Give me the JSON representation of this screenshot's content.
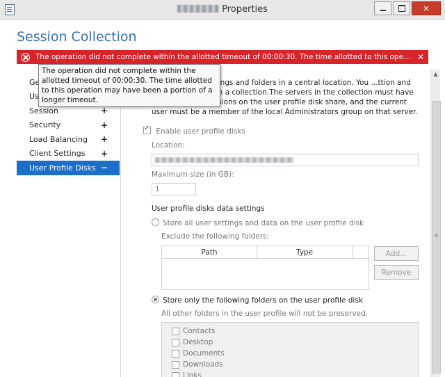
{
  "window": {
    "title": "Properties",
    "minimize_label": "",
    "maximize_label": "",
    "close_label": "✕"
  },
  "heading": "Session Collection",
  "error": {
    "message": "The operation did not complete within the allotted timeout of 00:00:30. The time allotted to this operation may hav...",
    "close_label": "✕",
    "icon": "error-circle-icon",
    "color": "#d7242b"
  },
  "tooltip": {
    "text": "The operation did not complete within the allotted timeout of 00:00:30. The time allotted to this operation may have been a portion of a longer timeout."
  },
  "sidebar": {
    "items": [
      {
        "label": "Ge",
        "sign": ""
      },
      {
        "label": "User Groups",
        "sign": "+"
      },
      {
        "label": "Session",
        "sign": "+"
      },
      {
        "label": "Security",
        "sign": "+"
      },
      {
        "label": "Load Balancing",
        "sign": "+"
      },
      {
        "label": "Client Settings",
        "sign": "+"
      },
      {
        "label": "User Profile Disks",
        "sign": "−"
      }
    ],
    "active_color": "#1c6fc9"
  },
  "content": {
    "description": "users to store settings and folders in a central location. You ...ttion and user profile disks in a collection.The servers in the collection must have full control permissions on the user profile disk share, and the current user must be a member of the local Administrators group on that server.",
    "enable_label": "Enable user profile disks",
    "location_label": "Location:",
    "location_value": "",
    "max_size_label": "Maximum size (in GB):",
    "max_size_value": "1",
    "data_settings_label": "User profile disks data settings",
    "option_all_label": "Store all user settings and data on the user profile disk",
    "exclude_label": "Exclude the following folders:",
    "grid_headers": [
      "Path",
      "Type"
    ],
    "add_button": "Add...",
    "remove_button": "Remove",
    "option_only_label": "Store only the following folders on the user profile disk",
    "not_preserved_label": "All other folders in the user profile will not be preserved.",
    "folders": [
      "Contacts",
      "Desktop",
      "Documents",
      "Downloads",
      "Links"
    ]
  }
}
